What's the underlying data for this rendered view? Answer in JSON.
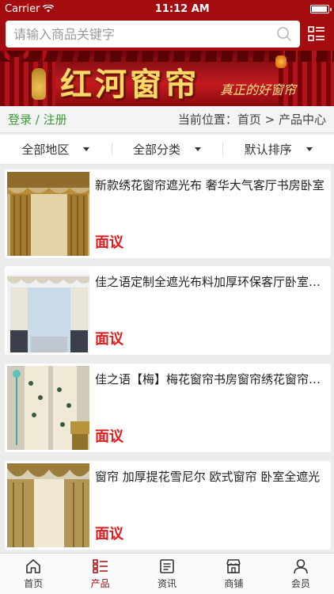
{
  "status": {
    "carrier": "Carrier",
    "time": "11:12 AM",
    "battery_level": 0.95
  },
  "search": {
    "placeholder": "请输入商品关键字"
  },
  "banner": {
    "title": "红河窗帘",
    "subtitle": "真正的好窗帘"
  },
  "auth": {
    "login": "登录",
    "separator": " / ",
    "register": "注册"
  },
  "location": {
    "label": "当前位置：",
    "home": "首页",
    "arrow": " > ",
    "current": "产品中心"
  },
  "filters": [
    {
      "label": "全部地区"
    },
    {
      "label": "全部分类"
    },
    {
      "label": "默认排序"
    }
  ],
  "products": [
    {
      "title": "新款绣花窗帘遮光布 奢华大气客厅书房卧室",
      "price": "面议"
    },
    {
      "title": "佳之语定制全遮光布料加厚环保客厅卧室窗帘",
      "price": "面议"
    },
    {
      "title": "佳之语【梅】梅花窗帘书房窗帘绣花窗帘成品",
      "price": "面议"
    },
    {
      "title": "窗帘 加厚提花雪尼尔 欧式窗帘 卧室全遮光",
      "price": "面议"
    }
  ],
  "tabs": [
    {
      "label": "首页",
      "icon": "home-icon",
      "active": false
    },
    {
      "label": "产品",
      "icon": "list-icon",
      "active": true
    },
    {
      "label": "资讯",
      "icon": "news-icon",
      "active": false
    },
    {
      "label": "商铺",
      "icon": "store-icon",
      "active": false
    },
    {
      "label": "会员",
      "icon": "user-icon",
      "active": false
    }
  ],
  "colors": {
    "brand": "#a40d10",
    "login_green": "#3d9a39",
    "price_red": "#e01b1b"
  }
}
